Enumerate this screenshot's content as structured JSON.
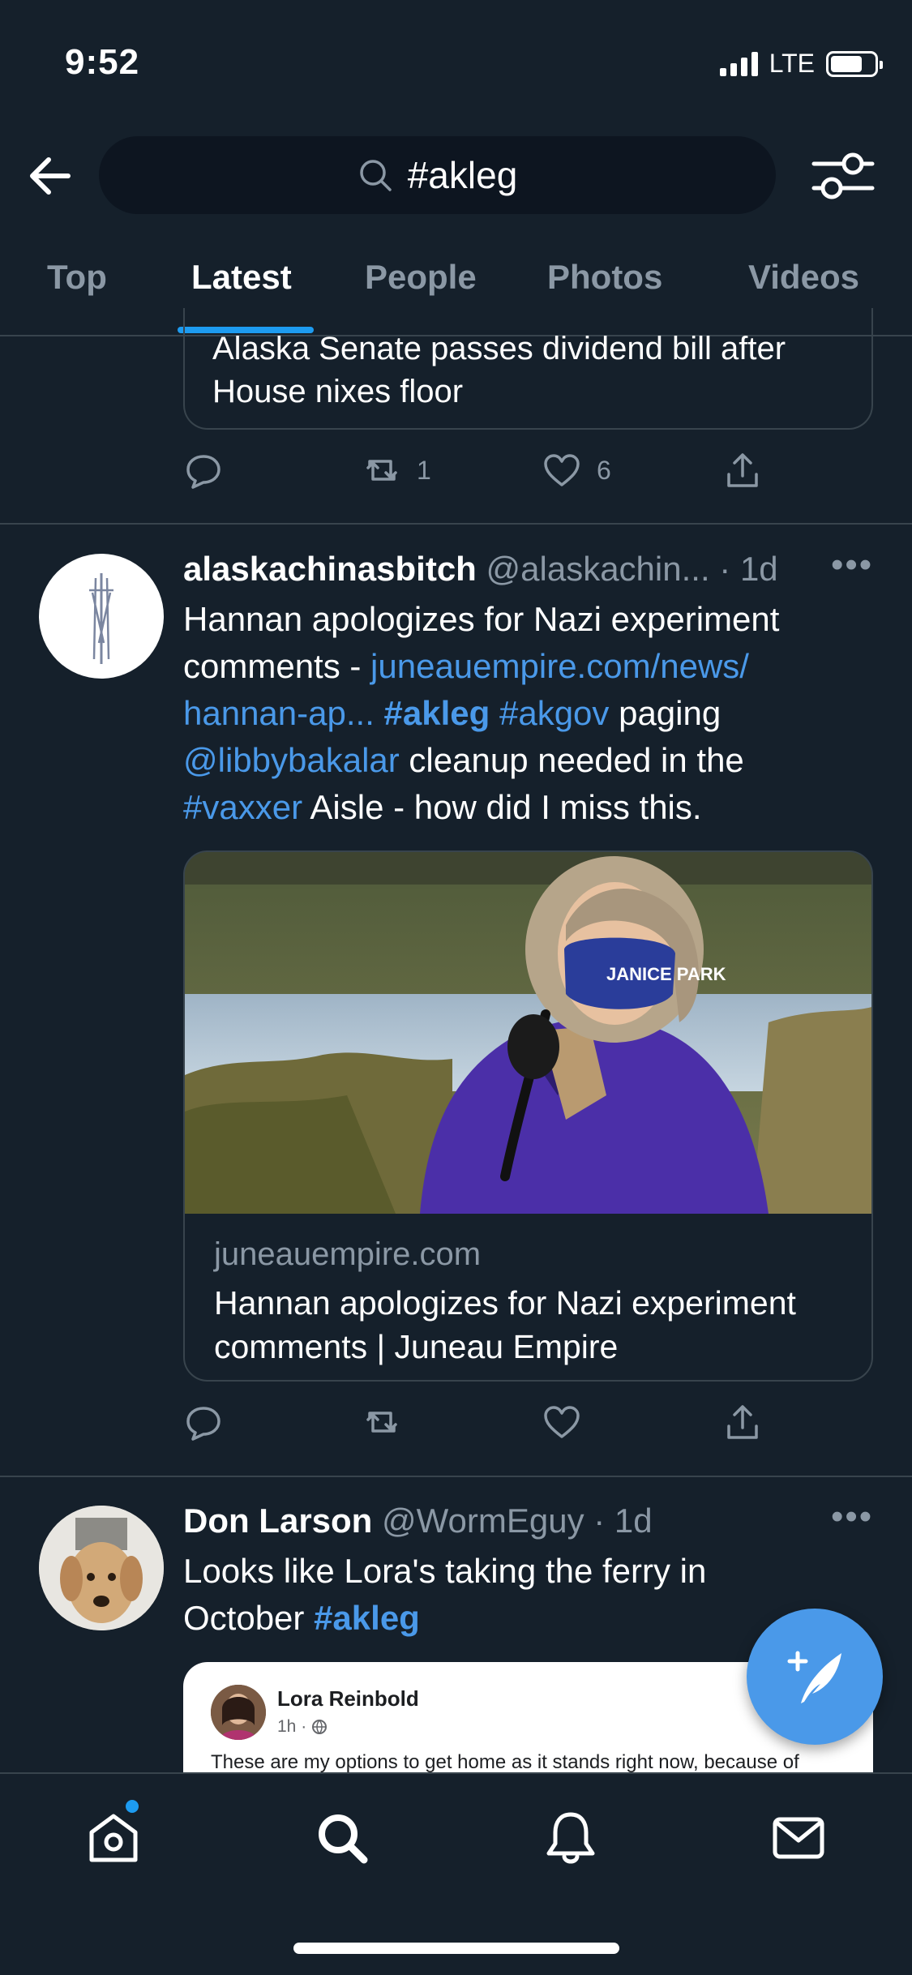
{
  "status_bar": {
    "time": "9:52",
    "network": "LTE"
  },
  "search": {
    "query": "#akleg"
  },
  "tabs": [
    {
      "label": "Top"
    },
    {
      "label": "Latest"
    },
    {
      "label": "People"
    },
    {
      "label": "Photos"
    },
    {
      "label": "Videos"
    }
  ],
  "tweet1": {
    "card_title": "Alaska Senate passes dividend bill after House nixes floor",
    "retweets": "1",
    "likes": "6"
  },
  "tweet2": {
    "display_name": "alaskachinasbitch",
    "handle": "@alaskachin...",
    "time": "· 1d",
    "body": {
      "t1": "Hannan apologizes for Nazi experiment comments - ",
      "link": "juneauempire.com/news/ hannan-ap...",
      "tag1": "#akleg",
      "tag2": "#akgov",
      "t2": " paging ",
      "mention": "@libbybakalar",
      "t3": " cleanup needed in the ",
      "tag3": "#vaxxer",
      "t4": " Aisle - how did I miss this."
    },
    "card": {
      "domain": "juneauempire.com",
      "title": "Hannan apologizes for Nazi experiment comments | Juneau Empire",
      "mask_text": "JANICE PARK"
    }
  },
  "tweet3": {
    "display_name": "Don Larson",
    "handle": "@WormEguy",
    "time": "· 1d",
    "body_text": "Looks like Lora's taking the ferry in October ",
    "tag": "#akleg",
    "embedded": {
      "name": "Lora Reinbold",
      "meta": "1h ·",
      "text": "These are my options to get home as it stands right now, because of"
    }
  },
  "colors": {
    "background": "#15202b",
    "accent": "#4a99e9",
    "muted": "#8b98a5",
    "divider": "#38444d"
  }
}
